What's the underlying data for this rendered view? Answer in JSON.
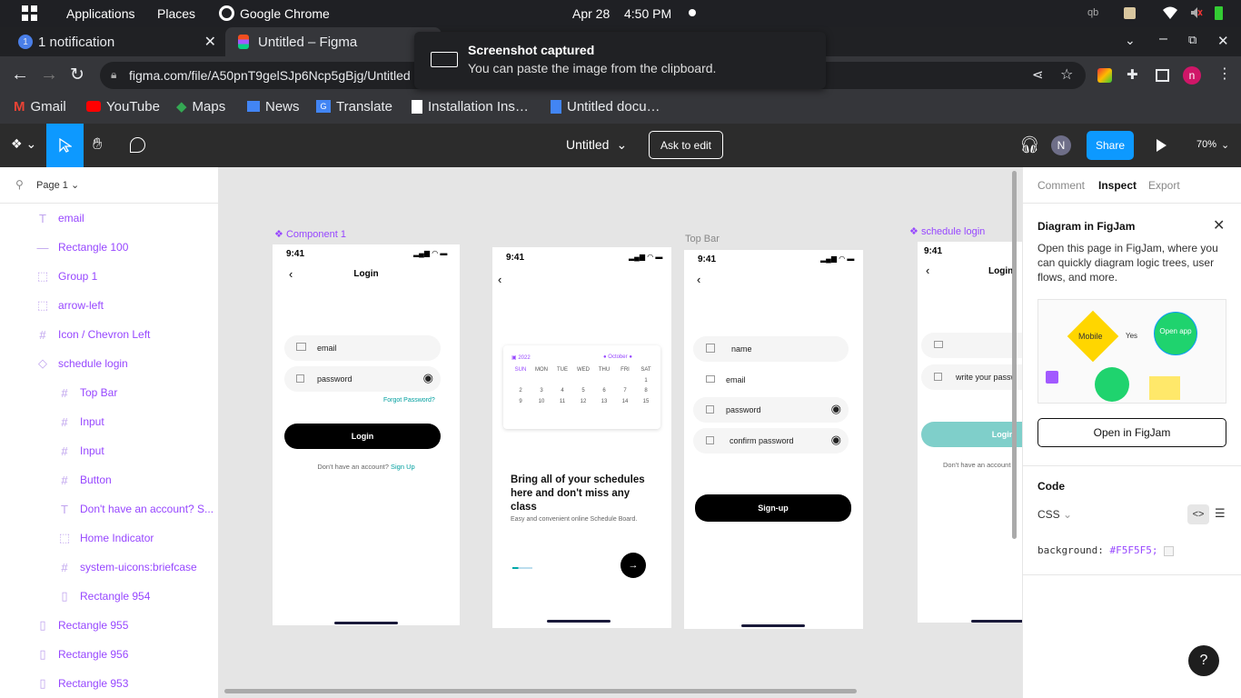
{
  "system": {
    "apps_menu": "Applications",
    "places_menu": "Places",
    "active_app": "Google Chrome",
    "date": "Apr 28",
    "time": "4:50 PM"
  },
  "browser": {
    "tabs": [
      {
        "label": "1 notification"
      },
      {
        "label": "Untitled – Figma"
      }
    ],
    "url": "figma.com/file/A50pnT9gelSJp6Ncp5gBjg/Untitled",
    "profile_initial": "n",
    "bookmarks": [
      "Gmail",
      "YouTube",
      "Maps",
      "News",
      "Translate",
      "Installation Ins…",
      "Untitled docu…"
    ]
  },
  "toast": {
    "title": "Screenshot captured",
    "message": "You can paste the image from the clipboard."
  },
  "figma": {
    "file_title": "Untitled",
    "ask_to_edit": "Ask to edit",
    "avatar_initial": "N",
    "share": "Share",
    "zoom": "70%",
    "page_name": "Page 1",
    "layers": [
      {
        "name": "email",
        "icon": "text-icon",
        "indent": 0
      },
      {
        "name": "Rectangle 100",
        "icon": "line-icon",
        "indent": 0
      },
      {
        "name": "Group 1",
        "icon": "group-icon",
        "indent": 0
      },
      {
        "name": "arrow-left",
        "icon": "group-icon",
        "indent": 0
      },
      {
        "name": "Icon / Chevron Left",
        "icon": "frame-icon",
        "indent": 0
      },
      {
        "name": "schedule login",
        "icon": "component-icon",
        "indent": 0
      },
      {
        "name": "Top Bar",
        "icon": "frame-icon",
        "indent": 1
      },
      {
        "name": "Input",
        "icon": "frame-icon",
        "indent": 1
      },
      {
        "name": "Input",
        "icon": "frame-icon",
        "indent": 1
      },
      {
        "name": "Button",
        "icon": "frame-icon",
        "indent": 1
      },
      {
        "name": "Don't have an account? S...",
        "icon": "text-icon",
        "indent": 1
      },
      {
        "name": "Home Indicator",
        "icon": "group-icon",
        "indent": 1
      },
      {
        "name": "system-uicons:briefcase",
        "icon": "frame-icon",
        "indent": 1
      },
      {
        "name": "Rectangle 954",
        "icon": "rectangle-icon",
        "indent": 1
      },
      {
        "name": "Rectangle 955",
        "icon": "rectangle-icon",
        "indent": 0
      },
      {
        "name": "Rectangle 956",
        "icon": "rectangle-icon",
        "indent": 0
      },
      {
        "name": "Rectangle 953",
        "icon": "rectangle-icon",
        "indent": 0
      }
    ],
    "right_tabs": [
      "Comment",
      "Inspect",
      "Export"
    ],
    "figjam_card": {
      "title": "Diagram in FigJam",
      "body": "Open this page in FigJam, where you can quickly diagram logic trees, user flows, and more.",
      "node_mobile": "Mobile",
      "node_yes": "Yes",
      "node_open": "Open app",
      "button": "Open in FigJam"
    },
    "code": {
      "heading": "Code",
      "lang": "CSS",
      "property": "background:",
      "value": "#F5F5F5;"
    },
    "help": "?"
  },
  "canvas": {
    "labels": {
      "component1": "Component 1",
      "topbar": "Top Bar",
      "schedule_login": "schedule login"
    },
    "login": {
      "time": "9:41",
      "title": "Login",
      "email": "email",
      "password": "password",
      "forgot": "Forgot Password?",
      "button": "Login",
      "no_account": "Don't have an account?",
      "signup": "Sign Up"
    },
    "onboard": {
      "time": "9:41",
      "year": "2022",
      "month": "October",
      "days": [
        "SUN",
        "MON",
        "TUE",
        "WED",
        "THU",
        "FRI",
        "SAT"
      ],
      "row1": [
        "",
        "",
        "",
        "",
        "",
        "",
        "1"
      ],
      "row2": [
        "2",
        "3",
        "4",
        "5",
        "6",
        "7",
        "8"
      ],
      "row3": [
        "9",
        "10",
        "11",
        "12",
        "13",
        "14",
        "15"
      ],
      "headline": "Bring all of your schedules here and don't miss any class",
      "sub": "Easy and convenient online Schedule Board."
    },
    "signup": {
      "time": "9:41",
      "name": "name",
      "email": "email",
      "password": "password",
      "confirm": "confirm password",
      "button": "Sign-up"
    },
    "schedule": {
      "time": "9:41",
      "title": "Login",
      "password_placeholder": "write your passw",
      "button": "Login",
      "no_account": "Don't have an account"
    }
  },
  "colors": {
    "purple": "#9747ff",
    "figma_blue": "#0d99ff",
    "teal": "#00a8a8"
  }
}
